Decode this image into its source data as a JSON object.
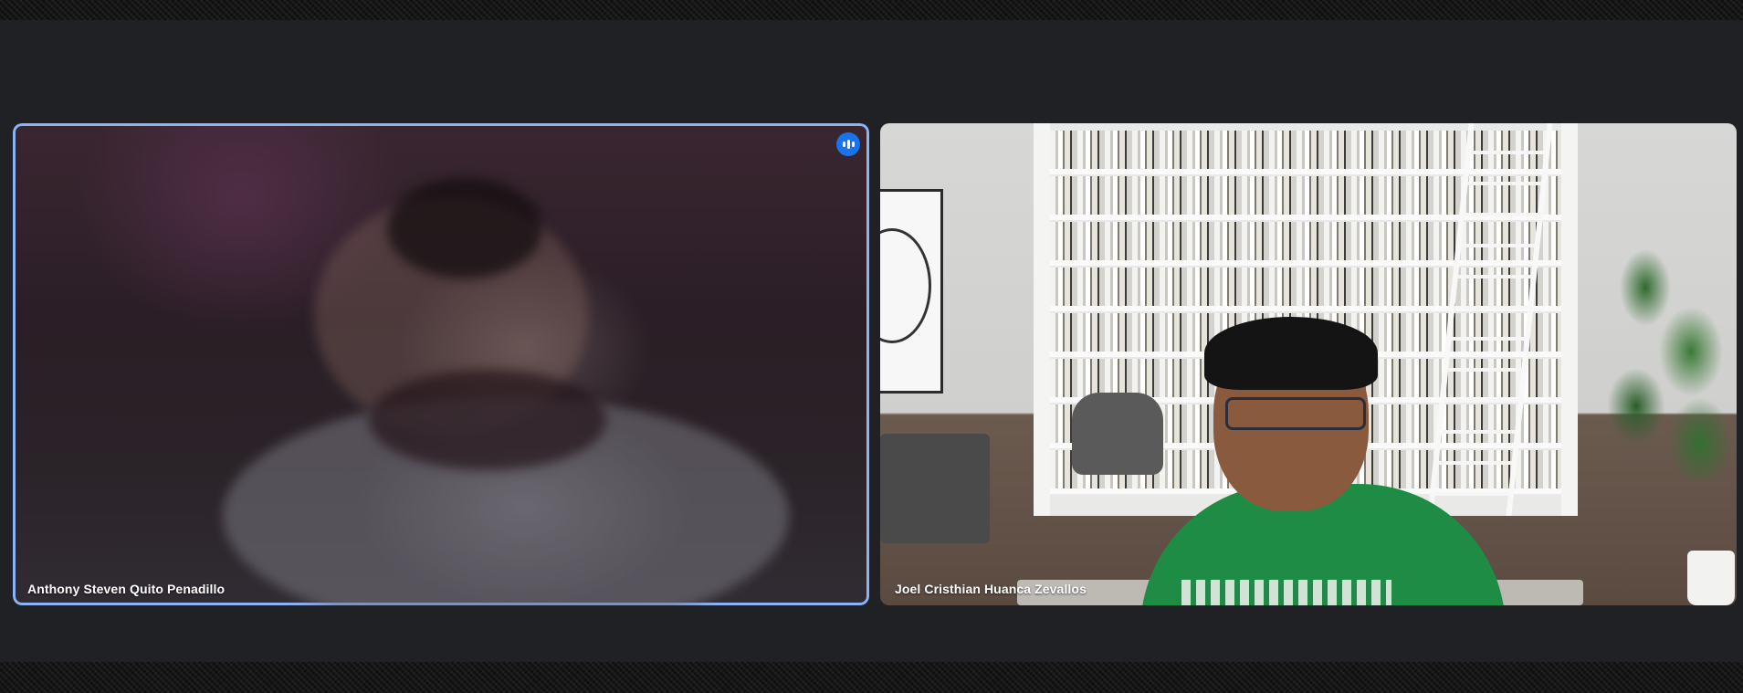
{
  "meeting": {
    "participants": [
      {
        "name": "Anthony Steven Quito Penadillo",
        "is_active_speaker": true
      },
      {
        "name": "Joel Cristhian Huanca Zevallos",
        "is_active_speaker": false
      }
    ]
  },
  "colors": {
    "stage_background": "#202124",
    "active_speaker_border": "#8ab4f8",
    "speaking_indicator": "#1a73e8"
  },
  "icons": {
    "speaking_indicator": "audio-level-icon"
  }
}
